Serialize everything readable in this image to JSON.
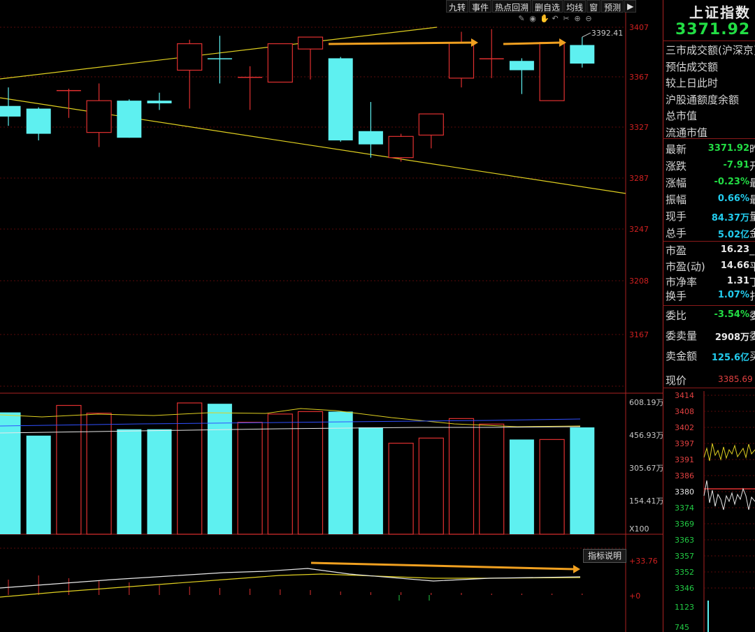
{
  "toolbar": {
    "buttons": [
      "九转",
      "事件",
      "热点回溯",
      "删自选",
      "均线",
      "窗",
      "预测"
    ],
    "icons": [
      "pen-icon",
      "eye-icon",
      "hand-icon",
      "undo-icon",
      "scissors-icon",
      "zoom-in-icon",
      "zoom-out-icon"
    ]
  },
  "price_axis": {
    "ticks": [
      "3407",
      "3367",
      "3327",
      "3287",
      "3247",
      "3208",
      "3167"
    ],
    "high_label": "3392.41"
  },
  "volume_axis": {
    "ticks": [
      "608.19万",
      "456.93万",
      "305.67万",
      "154.41万"
    ],
    "unit": "X100"
  },
  "indicator": {
    "button": "指标说明",
    "ticks": [
      "+33.76",
      "+0"
    ]
  },
  "chart_data": {
    "type": "candlestick",
    "price_range": [
      3130,
      3420
    ],
    "candles": [
      {
        "open": 3340,
        "close": 3332,
        "high": 3354,
        "low": 3325
      },
      {
        "open": 3338,
        "close": 3319,
        "high": 3339,
        "low": 3314
      },
      {
        "open": 3352,
        "close": 3352,
        "high": 3353,
        "low": 3331
      },
      {
        "open": 3320,
        "close": 3344,
        "high": 3357,
        "low": 3309
      },
      {
        "open": 3344,
        "close": 3316,
        "high": 3345,
        "low": 3316
      },
      {
        "open": 3344,
        "close": 3342,
        "high": 3350,
        "low": 3337
      },
      {
        "open": 3367,
        "close": 3387,
        "high": 3390,
        "low": 3338
      },
      {
        "open": 3376,
        "close": 3376,
        "high": 3393,
        "low": 3357
      },
      {
        "open": 3362,
        "close": 3362,
        "high": 3370,
        "low": 3337
      },
      {
        "open": 3358,
        "close": 3387,
        "high": 3387,
        "low": 3358
      },
      {
        "open": 3383,
        "close": 3392,
        "high": 3392,
        "low": 3360
      },
      {
        "open": 3376,
        "close": 3314,
        "high": 3377,
        "low": 3313
      },
      {
        "open": 3321,
        "close": 3311,
        "high": 3343,
        "low": 3301
      },
      {
        "open": 3301,
        "close": 3317,
        "high": 3319,
        "low": 3298
      },
      {
        "open": 3318,
        "close": 3334,
        "high": 3334,
        "low": 3308
      },
      {
        "open": 3361,
        "close": 3388,
        "high": 3396,
        "low": 3354
      },
      {
        "open": 3376,
        "close": 3376,
        "high": 3398,
        "low": 3361
      },
      {
        "open": 3374,
        "close": 3367,
        "high": 3376,
        "low": 3349
      },
      {
        "open": 3344,
        "close": 3388,
        "high": 3388,
        "low": 3344
      },
      {
        "open": 3386,
        "close": 3372,
        "high": 3392,
        "low": 3369
      }
    ],
    "volumes": [
      5.93,
      4.8,
      6.27,
      5.89,
      5.11,
      5.11,
      6.39,
      6.35,
      5.45,
      5.85,
      5.97,
      5.97,
      5.2,
      4.43,
      4.68,
      5.63,
      5.36,
      4.61,
      4.61,
      5.2
    ]
  },
  "side": {
    "title": "上证指数",
    "price": "3371.92",
    "info_labels": [
      "三市成交额(沪深京)",
      "预估成交额",
      "较上日此时",
      "沪股通额度余额",
      "总市值",
      "流通市值"
    ],
    "rows": [
      {
        "k": "最新",
        "v": "3371.92",
        "c": "#22dd44",
        "t": "昨"
      },
      {
        "k": "涨跌",
        "v": "-7.91",
        "c": "#22dd44",
        "t": "开"
      },
      {
        "k": "涨幅",
        "v": "-0.23%",
        "c": "#22dd44",
        "t": "最"
      },
      {
        "k": "振幅",
        "v": "0.66%",
        "c": "#22ccee",
        "t": "最"
      },
      {
        "k": "现手",
        "v": "84.37万",
        "c": "#22ccee",
        "t": "量"
      },
      {
        "k": "总手",
        "v": "5.02亿",
        "c": "#22ccee",
        "t": "金"
      },
      {
        "k": "市盈",
        "v": "16.23",
        "c": "#e8e8e8",
        "t": "_"
      },
      {
        "k": "市盈(动)",
        "v": "14.66",
        "c": "#e8e8e8",
        "t": "平"
      },
      {
        "k": "市净率",
        "v": "1.31",
        "c": "#e8e8e8",
        "t": "丁"
      },
      {
        "k": "换手",
        "v": "1.07%",
        "c": "#22ccee",
        "t": "扌"
      },
      {
        "k": "委比",
        "v": "-3.54%",
        "c": "#22dd44",
        "t": "委"
      },
      {
        "k": "委卖量",
        "v": "2908万",
        "c": "#e8e8e8",
        "t": "委"
      },
      {
        "k": "卖金额",
        "v": "125.6亿",
        "c": "#22ccee",
        "t": "买"
      }
    ],
    "current_label": "现价",
    "current_value": "3385.69",
    "mini_ticks": [
      "3414",
      "3408",
      "3402",
      "3397",
      "3391",
      "3386",
      "3380",
      "3374",
      "3369",
      "3363",
      "3357",
      "3352",
      "3346",
      "1123",
      "745"
    ]
  }
}
